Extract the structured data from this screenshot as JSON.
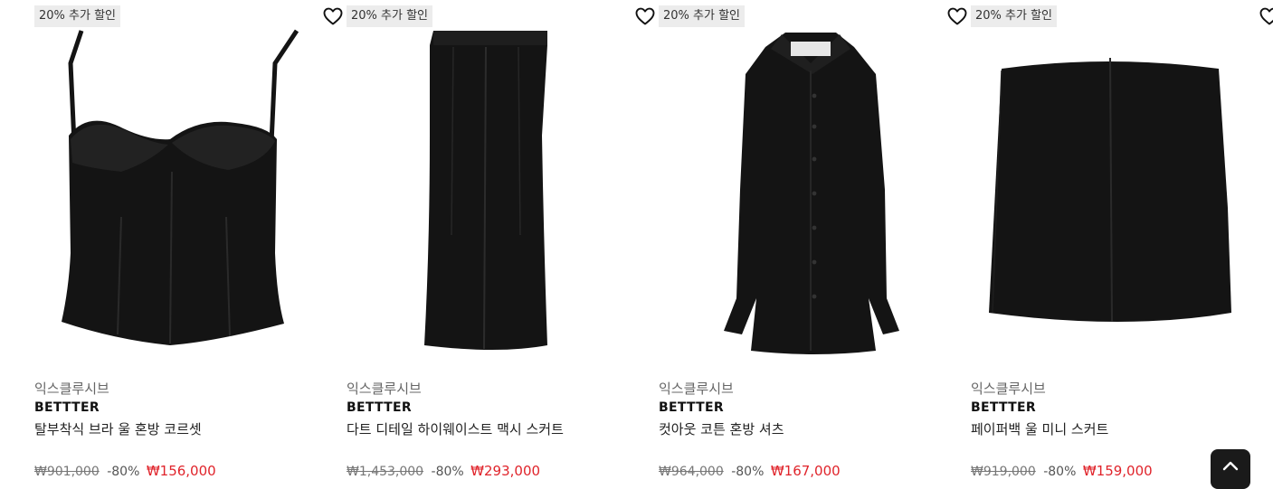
{
  "products": [
    {
      "badge": "20% 추가 할인",
      "category": "익스클루시브",
      "brand": "BETTTER",
      "name": "탈부착식 브라 울 혼방 코르셋",
      "original_price": "₩901,000",
      "discount": "-80%",
      "sale_price": "₩156,000",
      "image_icon": "corset-top"
    },
    {
      "badge": "20% 추가 할인",
      "category": "익스클루시브",
      "brand": "BETTTER",
      "name": "다트 디테일 하이웨이스트 맥시 스커트",
      "original_price": "₩1,453,000",
      "discount": "-80%",
      "sale_price": "₩293,000",
      "image_icon": "maxi-skirt"
    },
    {
      "badge": "20% 추가 할인",
      "category": "익스클루시브",
      "brand": "BETTTER",
      "name": "컷아웃 코튼 혼방 셔츠",
      "original_price": "₩964,000",
      "discount": "-80%",
      "sale_price": "₩167,000",
      "image_icon": "button-shirt"
    },
    {
      "badge": "20% 추가 할인",
      "category": "익스클루시브",
      "brand": "BETTTER",
      "name": "페이퍼백 울 미니 스커트",
      "original_price": "₩919,000",
      "discount": "-80%",
      "sale_price": "₩159,000",
      "image_icon": "mini-skirt"
    }
  ],
  "colors": {
    "badge_bg": "#ececec",
    "sale_price": "#e0242b",
    "garment": "#141414",
    "top_button_bg": "#1a1a1a"
  },
  "icons": {
    "wishlist": "heart-outline-icon",
    "back_to_top": "chevron-up-icon"
  }
}
